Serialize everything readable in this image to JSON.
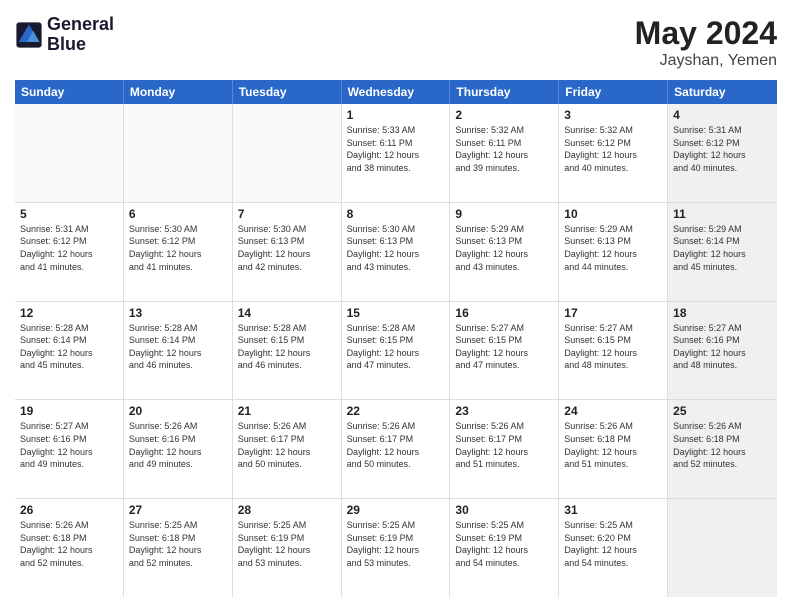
{
  "logo": {
    "line1": "General",
    "line2": "Blue"
  },
  "header": {
    "month": "May 2024",
    "location": "Jayshan, Yemen"
  },
  "weekdays": [
    "Sunday",
    "Monday",
    "Tuesday",
    "Wednesday",
    "Thursday",
    "Friday",
    "Saturday"
  ],
  "rows": [
    [
      {
        "day": "",
        "info": "",
        "empty": true
      },
      {
        "day": "",
        "info": "",
        "empty": true
      },
      {
        "day": "",
        "info": "",
        "empty": true
      },
      {
        "day": "1",
        "info": "Sunrise: 5:33 AM\nSunset: 6:11 PM\nDaylight: 12 hours\nand 38 minutes."
      },
      {
        "day": "2",
        "info": "Sunrise: 5:32 AM\nSunset: 6:11 PM\nDaylight: 12 hours\nand 39 minutes."
      },
      {
        "day": "3",
        "info": "Sunrise: 5:32 AM\nSunset: 6:12 PM\nDaylight: 12 hours\nand 40 minutes."
      },
      {
        "day": "4",
        "info": "Sunrise: 5:31 AM\nSunset: 6:12 PM\nDaylight: 12 hours\nand 40 minutes.",
        "shaded": true
      }
    ],
    [
      {
        "day": "5",
        "info": "Sunrise: 5:31 AM\nSunset: 6:12 PM\nDaylight: 12 hours\nand 41 minutes."
      },
      {
        "day": "6",
        "info": "Sunrise: 5:30 AM\nSunset: 6:12 PM\nDaylight: 12 hours\nand 41 minutes."
      },
      {
        "day": "7",
        "info": "Sunrise: 5:30 AM\nSunset: 6:13 PM\nDaylight: 12 hours\nand 42 minutes."
      },
      {
        "day": "8",
        "info": "Sunrise: 5:30 AM\nSunset: 6:13 PM\nDaylight: 12 hours\nand 43 minutes."
      },
      {
        "day": "9",
        "info": "Sunrise: 5:29 AM\nSunset: 6:13 PM\nDaylight: 12 hours\nand 43 minutes."
      },
      {
        "day": "10",
        "info": "Sunrise: 5:29 AM\nSunset: 6:13 PM\nDaylight: 12 hours\nand 44 minutes."
      },
      {
        "day": "11",
        "info": "Sunrise: 5:29 AM\nSunset: 6:14 PM\nDaylight: 12 hours\nand 45 minutes.",
        "shaded": true
      }
    ],
    [
      {
        "day": "12",
        "info": "Sunrise: 5:28 AM\nSunset: 6:14 PM\nDaylight: 12 hours\nand 45 minutes."
      },
      {
        "day": "13",
        "info": "Sunrise: 5:28 AM\nSunset: 6:14 PM\nDaylight: 12 hours\nand 46 minutes."
      },
      {
        "day": "14",
        "info": "Sunrise: 5:28 AM\nSunset: 6:15 PM\nDaylight: 12 hours\nand 46 minutes."
      },
      {
        "day": "15",
        "info": "Sunrise: 5:28 AM\nSunset: 6:15 PM\nDaylight: 12 hours\nand 47 minutes."
      },
      {
        "day": "16",
        "info": "Sunrise: 5:27 AM\nSunset: 6:15 PM\nDaylight: 12 hours\nand 47 minutes."
      },
      {
        "day": "17",
        "info": "Sunrise: 5:27 AM\nSunset: 6:15 PM\nDaylight: 12 hours\nand 48 minutes."
      },
      {
        "day": "18",
        "info": "Sunrise: 5:27 AM\nSunset: 6:16 PM\nDaylight: 12 hours\nand 48 minutes.",
        "shaded": true
      }
    ],
    [
      {
        "day": "19",
        "info": "Sunrise: 5:27 AM\nSunset: 6:16 PM\nDaylight: 12 hours\nand 49 minutes."
      },
      {
        "day": "20",
        "info": "Sunrise: 5:26 AM\nSunset: 6:16 PM\nDaylight: 12 hours\nand 49 minutes."
      },
      {
        "day": "21",
        "info": "Sunrise: 5:26 AM\nSunset: 6:17 PM\nDaylight: 12 hours\nand 50 minutes."
      },
      {
        "day": "22",
        "info": "Sunrise: 5:26 AM\nSunset: 6:17 PM\nDaylight: 12 hours\nand 50 minutes."
      },
      {
        "day": "23",
        "info": "Sunrise: 5:26 AM\nSunset: 6:17 PM\nDaylight: 12 hours\nand 51 minutes."
      },
      {
        "day": "24",
        "info": "Sunrise: 5:26 AM\nSunset: 6:18 PM\nDaylight: 12 hours\nand 51 minutes."
      },
      {
        "day": "25",
        "info": "Sunrise: 5:26 AM\nSunset: 6:18 PM\nDaylight: 12 hours\nand 52 minutes.",
        "shaded": true
      }
    ],
    [
      {
        "day": "26",
        "info": "Sunrise: 5:26 AM\nSunset: 6:18 PM\nDaylight: 12 hours\nand 52 minutes."
      },
      {
        "day": "27",
        "info": "Sunrise: 5:25 AM\nSunset: 6:18 PM\nDaylight: 12 hours\nand 52 minutes."
      },
      {
        "day": "28",
        "info": "Sunrise: 5:25 AM\nSunset: 6:19 PM\nDaylight: 12 hours\nand 53 minutes."
      },
      {
        "day": "29",
        "info": "Sunrise: 5:25 AM\nSunset: 6:19 PM\nDaylight: 12 hours\nand 53 minutes."
      },
      {
        "day": "30",
        "info": "Sunrise: 5:25 AM\nSunset: 6:19 PM\nDaylight: 12 hours\nand 54 minutes."
      },
      {
        "day": "31",
        "info": "Sunrise: 5:25 AM\nSunset: 6:20 PM\nDaylight: 12 hours\nand 54 minutes."
      },
      {
        "day": "",
        "info": "",
        "empty": true,
        "shaded": true
      }
    ]
  ]
}
